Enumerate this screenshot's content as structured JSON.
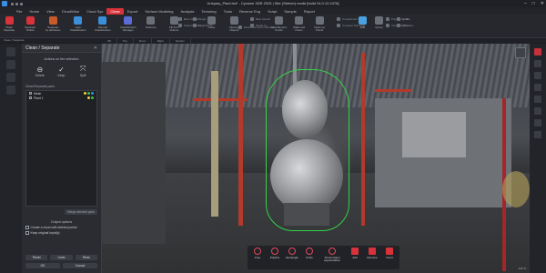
{
  "window": {
    "title": "Uniquey_Plant.lsd* - Cyclone 3DR 2025 | Site (Stretch) mode [build 24.0.12.2476]",
    "controls": [
      "–",
      "□",
      "✕"
    ]
  },
  "menu": {
    "tabs": [
      "File",
      "Home",
      "View",
      "CloudWise",
      "Cloud Sys",
      "Clean",
      "Export",
      "Surface Modeling",
      "Analysis",
      "Texturing",
      "Tools",
      "Reverse Eng",
      "Script",
      "Sample",
      "Report"
    ],
    "active_index": 5
  },
  "ribbon": {
    "buttons": [
      {
        "label": "Clean\nSeparate",
        "color": "#d8323a"
      },
      {
        "label": "Separate\nVisible",
        "color": "#d8323a"
      },
      {
        "label": "Separate\nby attributes",
        "color": "#c85a2a"
      },
      {
        "label": "Auto\nClassification",
        "color": "#3b8fd8"
      },
      {
        "label": "Manual\nClassification",
        "color": "#3b8fd8"
      },
      {
        "label": "Classification\nManager",
        "color": "#5b6cd8"
      },
      {
        "label": "Distance",
        "color": "#6b7078"
      },
      {
        "label": "Fill from\nVolume",
        "color": "#6b7078"
      },
      {
        "label": "Noise",
        "color": "#6b7078"
      },
      {
        "label": "Filtering\nObjects",
        "color": "#6b7078"
      },
      {
        "label": "Split Beyond\nPoints",
        "color": "#6b7078"
      },
      {
        "label": "Walls and\nFloors",
        "color": "#6b7078"
      },
      {
        "label": "Clean up\nPoints",
        "color": "#6b7078"
      },
      {
        "label": "Edit",
        "color": "#4aa2e0"
      },
      {
        "label": "Group",
        "color": "#6b7078"
      }
    ],
    "small_items": [
      "Best Cluster",
      "Scale Remove",
      "Single",
      "Neighbours",
      "Reference From Camera",
      "Best Cluster",
      "Divide by",
      "Complement",
      "Compact Point Set",
      "Polyline by 2D",
      "Close Polyline",
      "Isolate",
      "Fill Holes"
    ],
    "groups": [
      "Clean / Separate",
      "Cloud Automatic Segmentation",
      "Cloud Structure Filter",
      "Cloud Smart Filter",
      "Cloud Resampling",
      "Polyline Edition"
    ]
  },
  "viewport_tabs": [
    "3D",
    "Top",
    "Front",
    "Right",
    "Section"
  ],
  "panel": {
    "title": "Clean / Separate",
    "section_actions": "Actions on the selection",
    "actions": [
      {
        "label": "Delete",
        "glyph": "⊖"
      },
      {
        "label": "Keep",
        "glyph": "✓"
      },
      {
        "label": "Split",
        "glyph": "⤧"
      }
    ],
    "parts_header": "Clean/Separate parts",
    "parts": [
      {
        "name": "Mesh"
      },
      {
        "name": "Plant 1"
      }
    ],
    "merge_label": "Merge selected parts",
    "output_header": "Output options",
    "options": [
      "Create a cloud with deleted points",
      "Keep original input(s)"
    ],
    "footer_row1": [
      "Reset",
      "Undo",
      "Redo"
    ],
    "footer_row2": [
      "OK",
      "Cancel"
    ]
  },
  "selection_tools": [
    {
      "label": "Free"
    },
    {
      "label": "Polyline"
    },
    {
      "label": "Rectangle"
    },
    {
      "label": "Circle"
    },
    {
      "label": "Smart object\nsegmentation",
      "wide": true
    },
    {
      "label": "Add"
    },
    {
      "label": "Remove"
    },
    {
      "label": "Invert"
    }
  ],
  "viewport": {
    "zoom_label": "100 %"
  },
  "colors": {
    "accent": "#d8323a",
    "selection_boundary": "#35d14a",
    "panel_bg": "#2a2c31"
  }
}
